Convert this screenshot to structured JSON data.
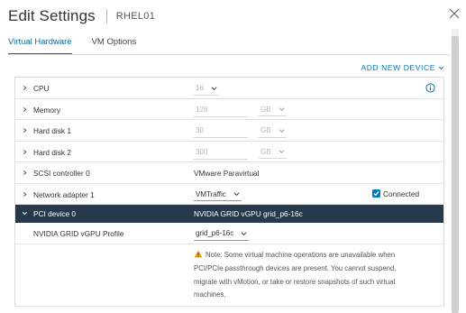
{
  "header": {
    "title": "Edit Settings",
    "vm_name": "RHEL01"
  },
  "tabs": [
    {
      "label": "Virtual Hardware",
      "active": true
    },
    {
      "label": "VM Options",
      "active": false
    }
  ],
  "add_new_device": "ADD NEW DEVICE",
  "rows": {
    "cpu": {
      "label": "CPU",
      "value": "16"
    },
    "memory": {
      "label": "Memory",
      "value": "128",
      "unit": "GB"
    },
    "hard_disk_1": {
      "label": "Hard disk 1",
      "value": "30",
      "unit": "GB"
    },
    "hard_disk_2": {
      "label": "Hard disk 2",
      "value": "300",
      "unit": "GB"
    },
    "scsi": {
      "label": "SCSI controller 0",
      "value": "VMware Paravirtual"
    },
    "network": {
      "label": "Network adapter 1",
      "value": "VMTraffic",
      "connected_label": "Connected",
      "connected": true
    },
    "pci": {
      "label": "PCI device 0",
      "value": "NVIDIA GRID vGPU grid_p6-16c"
    },
    "profile": {
      "label": "NVIDIA GRID vGPU Profile",
      "value": "grid_p6-16c"
    }
  },
  "note": {
    "line1": "Note: Some virtual machine operations are unavailable when",
    "line2": "PCI/PCIe passthrough devices are present. You cannot suspend,",
    "line3": "migrate with vMotion, or take or restore snapshots of such virtual",
    "line4": "machines."
  },
  "colors": {
    "accent": "#0079b8",
    "selected_row_bg": "#26394d",
    "warning": "#e8a317"
  },
  "icons": {
    "close": "close-icon",
    "info": "info-icon",
    "warning": "warning-icon",
    "expand": "chevron-right-icon",
    "collapse": "chevron-down-icon"
  }
}
